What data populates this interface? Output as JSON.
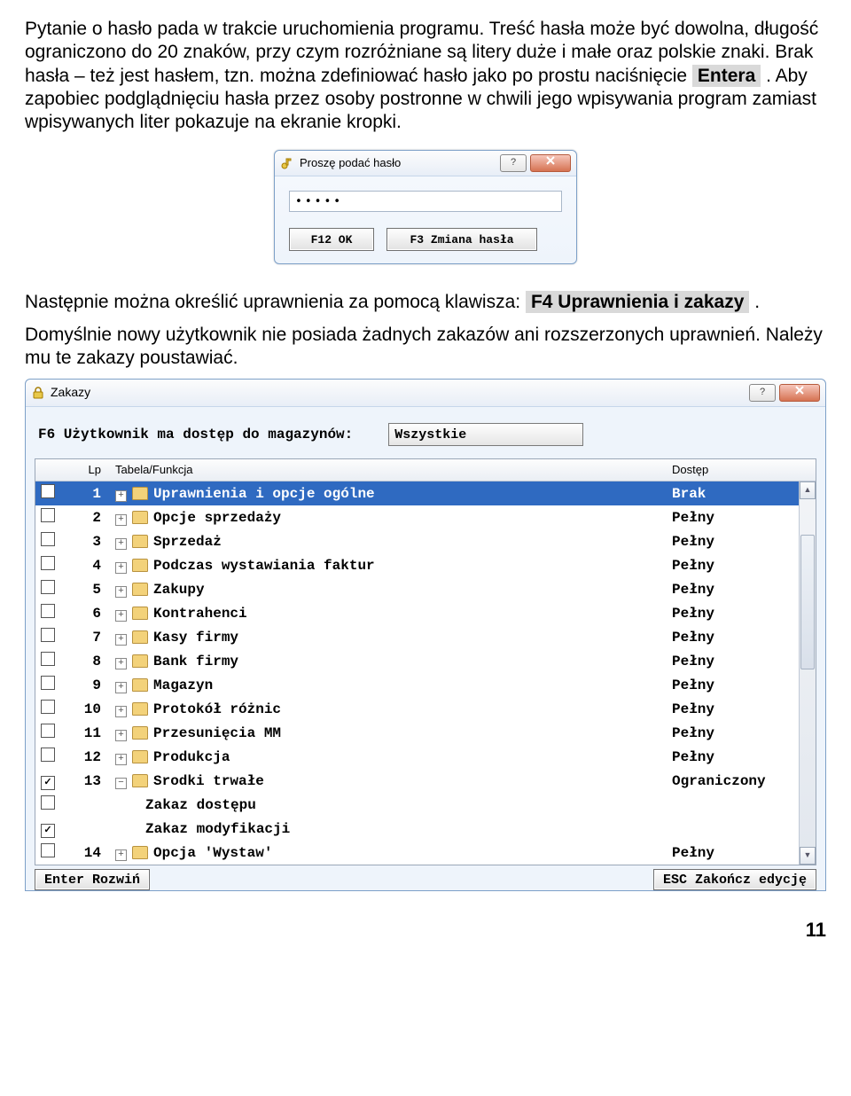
{
  "para1_a": "Pytanie o hasło pada w trakcie uruchomienia programu. Treść hasła może być dowolna, długość ograniczono do 20 znaków, przy czym rozróżniane są litery duże i małe oraz polskie znaki. Brak hasła – też jest hasłem, tzn. można zdefiniować hasło jako po prostu naciśnięcie ",
  "kbd_enter": "Entera",
  "para1_b": ". Aby zapobiec podglądnięciu hasła przez osoby postronne w chwili jego wpisywania program zamiast wpisywanych liter pokazuje na ekranie kropki.",
  "pw_dialog": {
    "title": "Proszę podać hasło",
    "input_value": "•••••",
    "btn_f12": "F12 OK",
    "btn_f3": "F3 Zmiana hasła",
    "help": "?"
  },
  "para2_a": "Następnie można określić uprawnienia za pomocą klawisza: ",
  "kbd_f4": "F4 Uprawnienia i zakazy",
  "para2_b": ".",
  "para3": "Domyślnie nowy użytkownik nie posiada żadnych zakazów ani rozszerzonych uprawnień. Należy mu te zakazy poustawiać.",
  "zakazy": {
    "title": "Zakazy",
    "toolbar_label": "F6 Użytkownik ma dostęp do magazynów:",
    "dropdown_value": "Wszystkie",
    "header": {
      "lp": "Lp",
      "tf": "Tabela/Funkcja",
      "ds": "Dostęp"
    },
    "rows": [
      {
        "lp": "1",
        "label": "Uprawnienia i opcje ogólne",
        "access": "Brak",
        "checked": false,
        "expand": "+",
        "folder": true,
        "selected": true
      },
      {
        "lp": "2",
        "label": "Opcje sprzedaży",
        "access": "Pełny",
        "checked": false,
        "expand": "+",
        "folder": true
      },
      {
        "lp": "3",
        "label": "Sprzedaż",
        "access": "Pełny",
        "checked": false,
        "expand": "+",
        "folder": true
      },
      {
        "lp": "4",
        "label": "Podczas wystawiania faktur",
        "access": "Pełny",
        "checked": false,
        "expand": "+",
        "folder": true
      },
      {
        "lp": "5",
        "label": "Zakupy",
        "access": "Pełny",
        "checked": false,
        "expand": "+",
        "folder": true
      },
      {
        "lp": "6",
        "label": "Kontrahenci",
        "access": "Pełny",
        "checked": false,
        "expand": "+",
        "folder": true
      },
      {
        "lp": "7",
        "label": "Kasy firmy",
        "access": "Pełny",
        "checked": false,
        "expand": "+",
        "folder": true
      },
      {
        "lp": "8",
        "label": "Bank firmy",
        "access": "Pełny",
        "checked": false,
        "expand": "+",
        "folder": true
      },
      {
        "lp": "9",
        "label": "Magazyn",
        "access": "Pełny",
        "checked": false,
        "expand": "+",
        "folder": true
      },
      {
        "lp": "10",
        "label": "Protokół różnic",
        "access": "Pełny",
        "checked": false,
        "expand": "+",
        "folder": true
      },
      {
        "lp": "11",
        "label": "Przesunięcia MM",
        "access": "Pełny",
        "checked": false,
        "expand": "+",
        "folder": true
      },
      {
        "lp": "12",
        "label": "Produkcja",
        "access": "Pełny",
        "checked": false,
        "expand": "+",
        "folder": true
      },
      {
        "lp": "13",
        "label": "Srodki trwałe",
        "access": "Ograniczony",
        "checked": true,
        "expand": "−",
        "folder": true
      },
      {
        "lp": "",
        "label": "Zakaz dostępu",
        "access": "",
        "checked": false,
        "expand": "",
        "folder": false,
        "indent": true
      },
      {
        "lp": "",
        "label": "Zakaz modyfikacji",
        "access": "",
        "checked": true,
        "expand": "",
        "folder": false,
        "indent": true
      },
      {
        "lp": "14",
        "label": "Opcja 'Wystaw'",
        "access": "Pełny",
        "checked": false,
        "expand": "+",
        "folder": true
      }
    ],
    "footer_enter": "Enter Rozwiń",
    "footer_esc": "ESC Zakończ edycję"
  },
  "page_number": "11"
}
